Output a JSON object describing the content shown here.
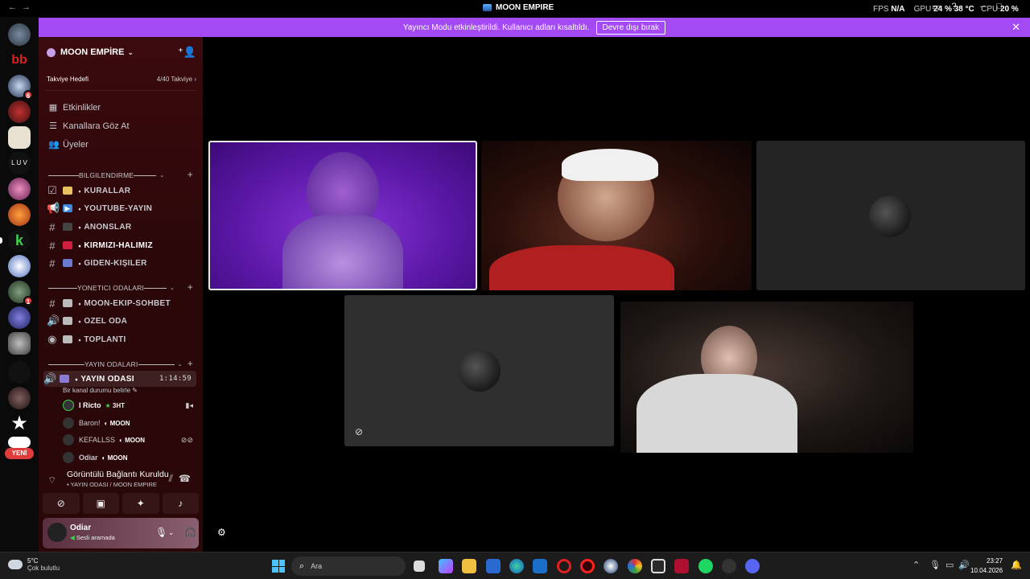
{
  "titlebar": {
    "title": "MOON EMPIRE",
    "stats": {
      "fps_label": "FPS",
      "fps_value": "N/A",
      "gpu_label": "GPU",
      "gpu_value": "24 %",
      "gpu_temp": "38 °C",
      "cpu_label": "CPU",
      "cpu_value": "20 %"
    }
  },
  "banner": {
    "message": "Yayıncı Modu etkinleştirildi. Kullanıcı adları kısaltıldı.",
    "button": "Devre dışı bırak",
    "close": "✕"
  },
  "rail": {
    "badge_1": "6",
    "badge_2": "1",
    "new_label": "YENİ"
  },
  "server": {
    "name": "MOON EMPİRE",
    "boost_label": "Takviye Hedefi",
    "boost_progress": "4/40 Takviye"
  },
  "nav": {
    "events": "Etkinlikler",
    "browse": "Kanallara Göz At",
    "members": "Üyeler"
  },
  "categories": {
    "info": "BILGILENDIRME",
    "admin": "YONETICI ODALARI",
    "stream": "YAYIN ODALARI"
  },
  "channels": {
    "rules": "KURALLAR",
    "youtube": "YOUTUBE-YAYIN",
    "announce": "ANONSLAR",
    "red": "KIRMIZI-HALIMIZ",
    "leaving": "GIDEN-KIŞILER",
    "team_chat": "MOON-EKIP-SOHBET",
    "private": "OZEL ODA",
    "meeting": "TOPLANTI",
    "stream_room": "YAYIN ODASI",
    "stream_time": "1:14:59",
    "stream_status": "Bir kanal durumu belirle"
  },
  "voice_users": [
    {
      "name": "I Ricto",
      "tag": "3HT"
    },
    {
      "name": "Baron!",
      "tag": "MOON"
    },
    {
      "name": "KEFALLSS",
      "tag": "MOON"
    },
    {
      "name": "Odiar",
      "tag": "MOON"
    }
  ],
  "voice_panel": {
    "status": "Görüntülü Bağlantı Kuruldu",
    "location": "YAYIN ODASI / MOON EMPIRE"
  },
  "user": {
    "name": "Odiar",
    "status": "Sesli aramada"
  },
  "taskbar": {
    "temp": "5°C",
    "weather": "Çok bulutlu",
    "search": "Ara",
    "time": "23:27",
    "date": "10.04.2026"
  }
}
